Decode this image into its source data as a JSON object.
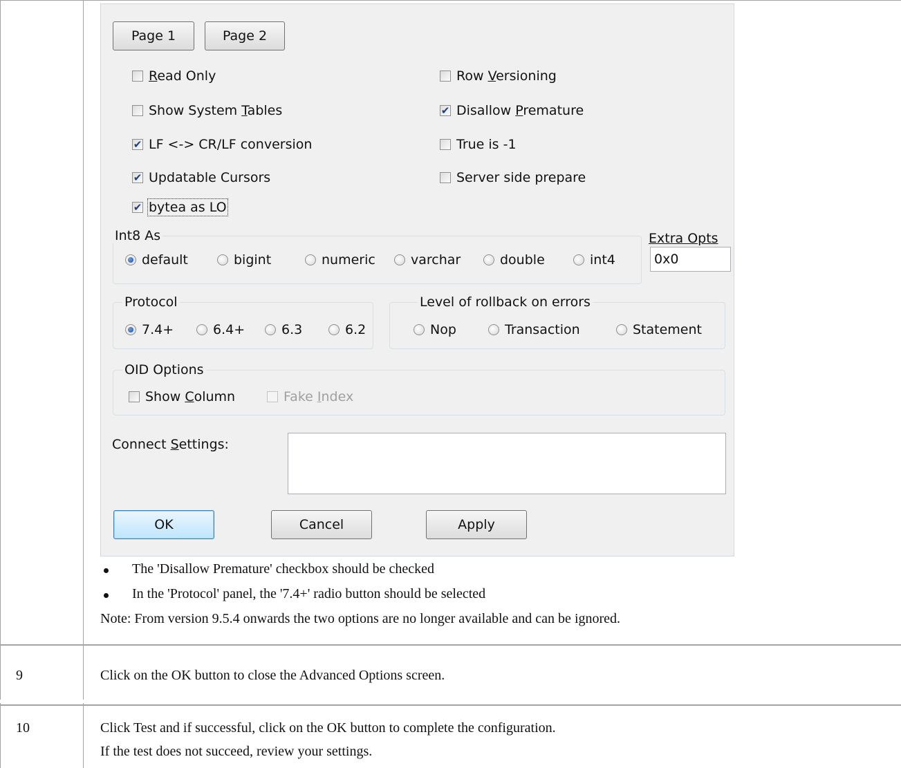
{
  "dialog": {
    "page_tabs": [
      "Page 1",
      "Page 2"
    ],
    "checkboxes_left": [
      {
        "pre": "",
        "key": "R",
        "post": "ead Only",
        "checked": false
      },
      {
        "pre": "Show System ",
        "key": "T",
        "post": "ables",
        "checked": false
      },
      {
        "pre": "LF <-> CR/LF conversion",
        "key": "",
        "post": "",
        "checked": true
      },
      {
        "pre": "Updatable Cursors",
        "key": "",
        "post": "",
        "checked": true
      },
      {
        "pre": "bytea as LO",
        "key": "",
        "post": "",
        "checked": true
      }
    ],
    "checkboxes_right": [
      {
        "pre": "Row ",
        "key": "V",
        "post": "ersioning",
        "checked": false
      },
      {
        "pre": "Disallow ",
        "key": "P",
        "post": "remature",
        "checked": true
      },
      {
        "pre": "True is -1",
        "key": "",
        "post": "",
        "checked": false
      },
      {
        "pre": "Server side prepare",
        "key": "",
        "post": "",
        "checked": false
      }
    ],
    "int8": {
      "title": "Int8 As",
      "options": [
        "default",
        "bigint",
        "numeric",
        "varchar",
        "double",
        "int4"
      ],
      "selected": "default"
    },
    "extra_opts": {
      "label": "Extra Opts",
      "value": "0x0"
    },
    "protocol": {
      "title": "Protocol",
      "options": [
        "7.4+",
        "6.4+",
        "6.3",
        "6.2"
      ],
      "selected": "7.4+"
    },
    "rollback": {
      "title": "Level of rollback on errors",
      "options": [
        "Nop",
        "Transaction",
        "Statement"
      ],
      "selected": ""
    },
    "oid": {
      "title": "OID Options",
      "show_column": {
        "pre": "Show ",
        "key": "C",
        "post": "olumn",
        "checked": false
      },
      "fake_index": {
        "pre": "Fake ",
        "key": "I",
        "post": "ndex",
        "checked": false,
        "disabled": true
      }
    },
    "connect_settings": {
      "pre": "Connect ",
      "key": "S",
      "post": "ettings:",
      "value": ""
    },
    "buttons": {
      "ok": "OK",
      "cancel": "Cancel",
      "apply": "Apply"
    }
  },
  "notes": {
    "bullets": [
      "The 'Disallow Premature' checkbox should be checked",
      "In the 'Protocol' panel, the '7.4+' radio button should be selected"
    ],
    "note": "Note: From version 9.5.4 onwards the two options are no longer available and can be ignored."
  },
  "steps": [
    {
      "num": "9",
      "text": [
        "Click on the OK button to close the Advanced Options screen."
      ]
    },
    {
      "num": "10",
      "text": [
        "Click Test and if successful, click on the OK button to complete the configuration.",
        "If the test does not succeed, review your settings."
      ]
    }
  ]
}
